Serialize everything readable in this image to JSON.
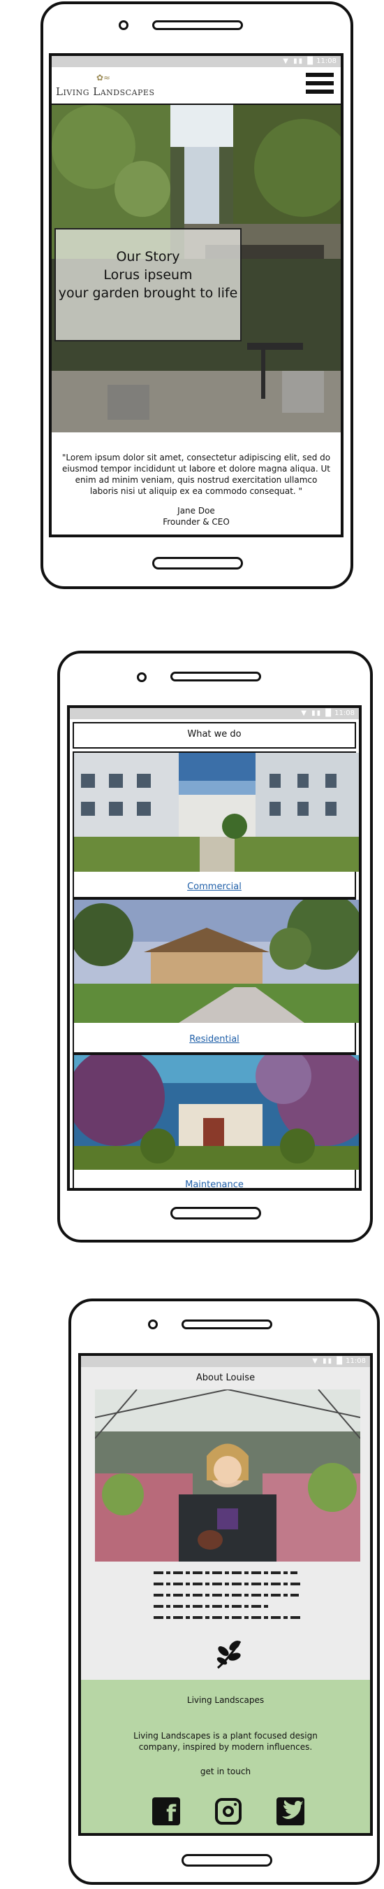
{
  "status_bar": {
    "time": "11:08"
  },
  "screen1": {
    "brand_name": "Living Landscapes",
    "menu_icon": "hamburger-menu-icon",
    "hero": {
      "line1": "Our Story",
      "line2": "Lorus ipseum",
      "line3": "your garden brought to life"
    },
    "quote": "\"Lorem ipsum dolor sit amet, consectetur adipiscing elit, sed do eiusmod tempor incididunt ut labore et dolore magna aliqua. Ut enim ad minim veniam, quis nostrud exercitation ullamco laboris nisi ut aliquip ex ea commodo consequat. \"",
    "author_name": "Jane Doe",
    "author_title": "Frounder & CEO"
  },
  "screen2": {
    "heading": "What we do",
    "cards": [
      {
        "label": "Commercial"
      },
      {
        "label": "Residential"
      },
      {
        "label": "Maintenance"
      }
    ]
  },
  "screen3": {
    "heading": "About Louise",
    "leaf_icon": "leaf-sprig-icon",
    "footer": {
      "title": "Living Landscapes",
      "description": "Living Landscapes is a plant focused design company, inspired by modern influences.",
      "cta": "get in touch",
      "social": [
        "facebook-icon",
        "instagram-icon",
        "twitter-icon"
      ]
    }
  },
  "colors": {
    "footer_bg": "#b7d6a5",
    "link": "#1f5fa8",
    "status_bar": "#d2d2d2",
    "gray_panel": "#ececec"
  }
}
